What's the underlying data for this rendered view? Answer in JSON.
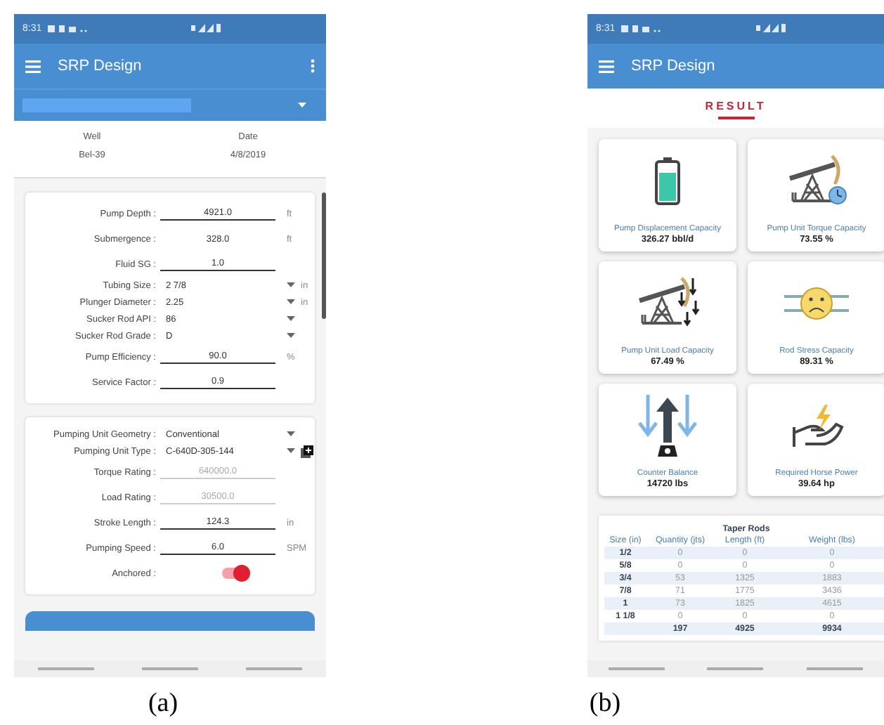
{
  "screens": [
    {
      "caption": "(a)",
      "status_time": "8:31",
      "app_title": "SRP Design",
      "well": {
        "label": "Well",
        "value": "Bel-39"
      },
      "date": {
        "label": "Date",
        "value": "4/8/2019"
      },
      "cards": [
        {
          "fields": [
            {
              "label": "Pump Depth :",
              "value": "4921.0",
              "unit": "ft",
              "kind": "input"
            },
            {
              "label": "Submergence :",
              "value": "328.0",
              "unit": "ft",
              "kind": "plain"
            },
            {
              "label": "Fluid SG :",
              "value": "1.0",
              "kind": "input"
            },
            {
              "label": "Tubing Size :",
              "value": "2 7/8",
              "unit": "in",
              "kind": "select"
            },
            {
              "label": "Plunger Diameter :",
              "value": "2.25",
              "unit": "in",
              "kind": "select"
            },
            {
              "label": "Sucker Rod API :",
              "value": "86",
              "kind": "select"
            },
            {
              "label": "Sucker Rod Grade :",
              "value": "D",
              "kind": "select"
            },
            {
              "label": "Pump Efficiency :",
              "value": "90.0",
              "unit": "%",
              "kind": "input"
            },
            {
              "label": "Service Factor :",
              "value": "0.9",
              "kind": "input"
            }
          ]
        },
        {
          "fields": [
            {
              "label": "Pumping Unit Geometry :",
              "value": "Conventional",
              "kind": "select"
            },
            {
              "label": "Pumping Unit Type :",
              "value": "C-640D-305-144",
              "kind": "select_add"
            },
            {
              "label": "Torque Rating :",
              "value": "640000.0",
              "kind": "disabled"
            },
            {
              "label": "Load Rating :",
              "value": "30500.0",
              "kind": "disabled"
            },
            {
              "label": "Stroke Length :",
              "value": "124.3",
              "unit": "in",
              "kind": "input"
            },
            {
              "label": "Pumping Speed :",
              "value": "6.0",
              "unit": "SPM",
              "kind": "input"
            },
            {
              "label": "Anchored :",
              "kind": "toggle",
              "on": true
            }
          ]
        }
      ]
    },
    {
      "caption": "(b)",
      "status_time": "8:31",
      "app_title": "SRP Design",
      "section_title": "RESULT",
      "results": [
        {
          "label": "Pump Displacement Capacity",
          "value": "326.27 bbl/d"
        },
        {
          "label": "Pump Unit Torque Capacity",
          "value": "73.55 %"
        },
        {
          "label": "Pump Unit Load Capacity",
          "value": "67.49 %"
        },
        {
          "label": "Rod Stress Capacity",
          "value": "89.31 %"
        },
        {
          "label": "Counter Balance",
          "value": "14720 lbs"
        },
        {
          "label": "Required Horse Power",
          "value": "39.64 hp"
        }
      ],
      "table": {
        "title": "Taper Rods",
        "columns": [
          "Size (in)",
          "Quantity (jts)",
          "Length (ft)",
          "Weight (lbs)"
        ],
        "rows": [
          [
            "1/2",
            "0",
            "0",
            "0"
          ],
          [
            "5/8",
            "0",
            "0",
            "0"
          ],
          [
            "3/4",
            "53",
            "1325",
            "1883"
          ],
          [
            "7/8",
            "71",
            "1775",
            "3436"
          ],
          [
            "1",
            "73",
            "1825",
            "4615"
          ],
          [
            "1 1/8",
            "0",
            "0",
            "0"
          ]
        ],
        "total": [
          "197",
          "4925",
          "9934"
        ]
      }
    }
  ]
}
